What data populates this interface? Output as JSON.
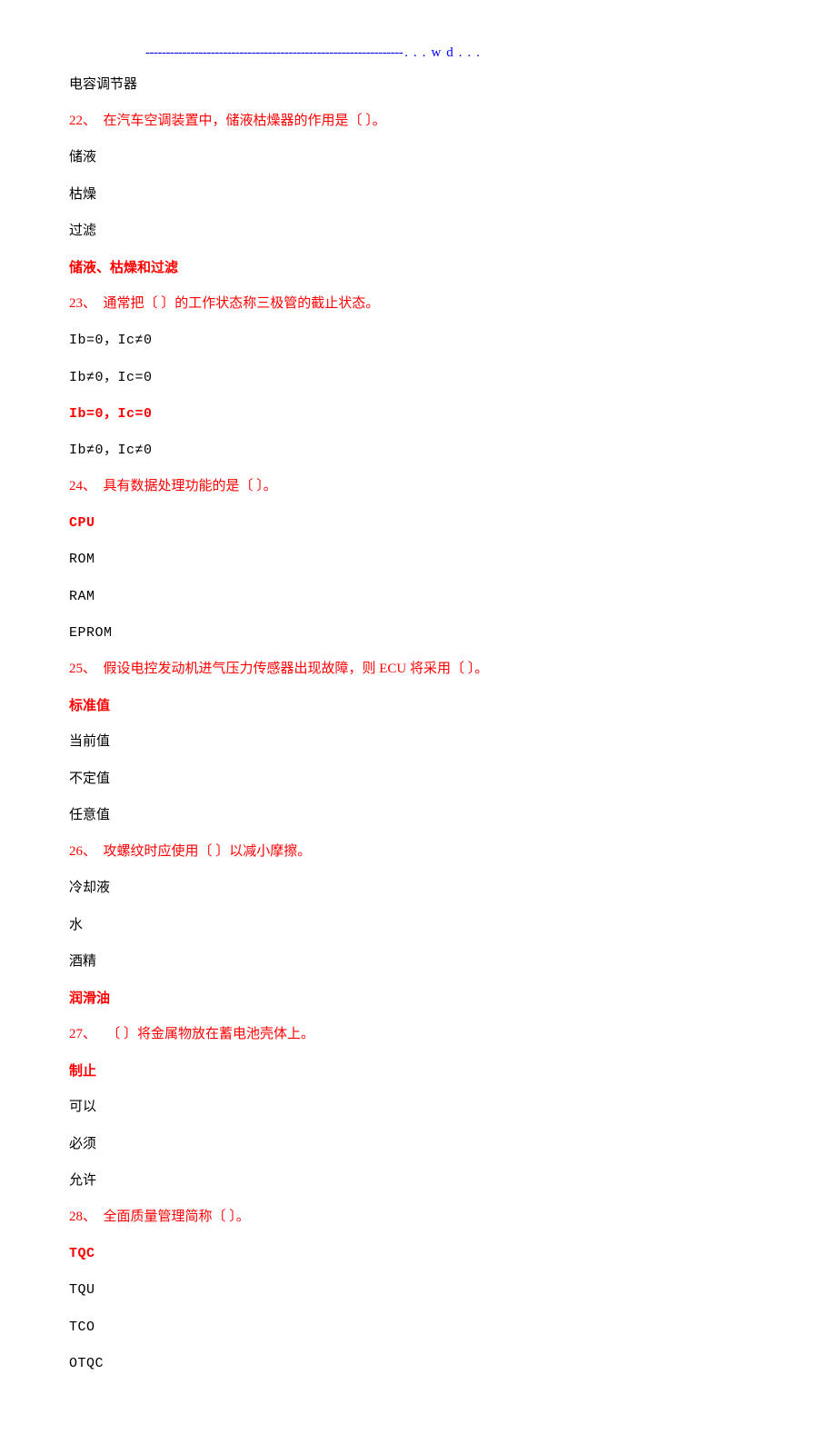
{
  "header": {
    "dashes": "---------------------------------------------------------------",
    "wd": "...wd..."
  },
  "preline": "电容调节器",
  "questions": [
    {
      "number": "22、",
      "text": "在汽车空调装置中，储液枯燥器的作用是〔 〕。",
      "options": [
        "储液",
        "枯燥",
        "过滤"
      ],
      "answer": "储液、枯燥和过滤",
      "postOptions": []
    },
    {
      "number": "23、",
      "text": "通常把〔 〕的工作状态称三极管的截止状态。",
      "options": [
        "Ib=0，Ic≠0",
        "Ib≠0，Ic=0"
      ],
      "answer": "Ib=0，Ic=0",
      "postOptions": [
        "Ib≠0，Ic≠0"
      ],
      "mono": true
    },
    {
      "number": "24、",
      "text": "具有数据处理功能的是〔 〕。",
      "options": [],
      "answer": "CPU",
      "postOptions": [
        "ROM",
        "RAM",
        "EPROM"
      ],
      "mono": true
    },
    {
      "number": "25、",
      "text": "假设电控发动机进气压力传感器出现故障，则 ECU 将采用〔 〕。",
      "options": [],
      "answer": "标准值",
      "postOptions": [
        "当前值",
        "不定值",
        "任意值"
      ]
    },
    {
      "number": "26、",
      "text": "攻螺纹时应使用〔 〕以减小摩擦。",
      "options": [
        "冷却液",
        "水",
        "酒精"
      ],
      "answer": "润滑油",
      "postOptions": []
    },
    {
      "number": "27、",
      "text": "〔 〕将金属物放在蓄电池壳体上。",
      "options": [],
      "answer": "制止",
      "postOptions": [
        "可以",
        "必须",
        "允许"
      ]
    },
    {
      "number": "28、",
      "text": "全面质量管理简称〔 〕。",
      "options": [],
      "answer": "TQC",
      "postOptions": [
        "TQU",
        "TCO",
        "OTQC"
      ],
      "mono": true
    }
  ]
}
